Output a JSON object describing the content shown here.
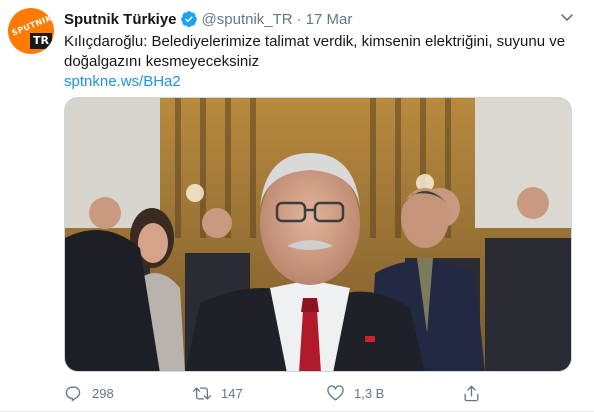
{
  "tweet": {
    "avatar_brand": "SPUTNIK",
    "avatar_badge": "TR",
    "author_name": "Sputnik Türkiye",
    "handle": "@sputnik_TR",
    "separator": "·",
    "date": "17 Mar",
    "text": "Kılıçdaroğlu: Belediyelerimize talimat verdik, kimsenin elektriğini, suyunu ve doğalgazını kesmeyeceksiniz",
    "link": "sptnkne.ws/BHa2",
    "actions": {
      "reply_count": "298",
      "retweet_count": "147",
      "like_count": "1,3 B"
    }
  },
  "icons": {
    "verified": "verified-badge-icon",
    "menu": "chevron-down-icon",
    "reply": "reply-icon",
    "retweet": "retweet-icon",
    "like": "heart-icon",
    "share": "share-icon"
  },
  "colors": {
    "accent": "#1da1f2",
    "link": "#1b95e0",
    "muted": "#657786",
    "avatar_orange": "#ff7a00"
  }
}
